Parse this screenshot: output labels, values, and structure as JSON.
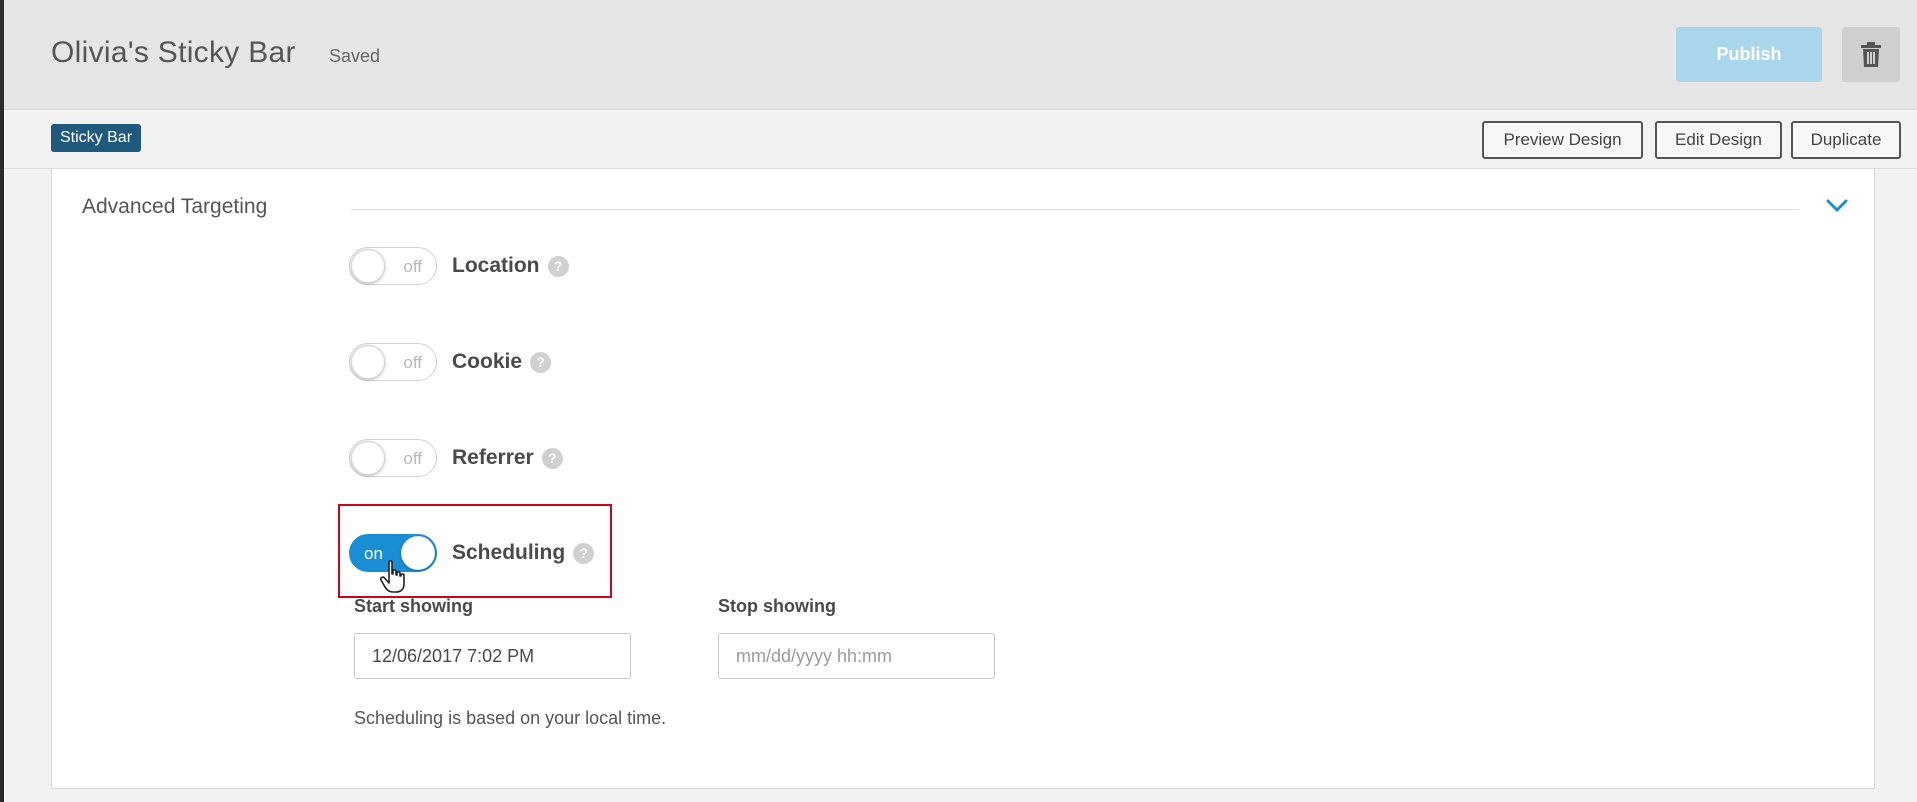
{
  "header": {
    "title": "Olivia's Sticky Bar",
    "status": "Saved",
    "publish_label": "Publish",
    "trash_icon": "trash-icon",
    "publish_color": "#a9d6ec"
  },
  "subbar": {
    "tag": "Sticky Bar",
    "tag_color": "#1f5a7e",
    "preview_label": "Preview Design",
    "edit_label": "Edit Design",
    "duplicate_label": "Duplicate"
  },
  "targeting": {
    "title": "Advanced Targeting",
    "toggles": [
      {
        "label": "Location",
        "state": "off"
      },
      {
        "label": "Cookie",
        "state": "off"
      },
      {
        "label": "Referrer",
        "state": "off"
      },
      {
        "label": "Scheduling",
        "state": "on"
      }
    ],
    "help_glyph": "?",
    "start_label": "Start showing",
    "start_value": "12/06/2017 7:02 PM",
    "stop_label": "Stop showing",
    "stop_placeholder": "mm/dd/yyyy hh:mm",
    "note": "Scheduling is based on your local time.",
    "toggle_on_color": "#1a8ed4"
  }
}
